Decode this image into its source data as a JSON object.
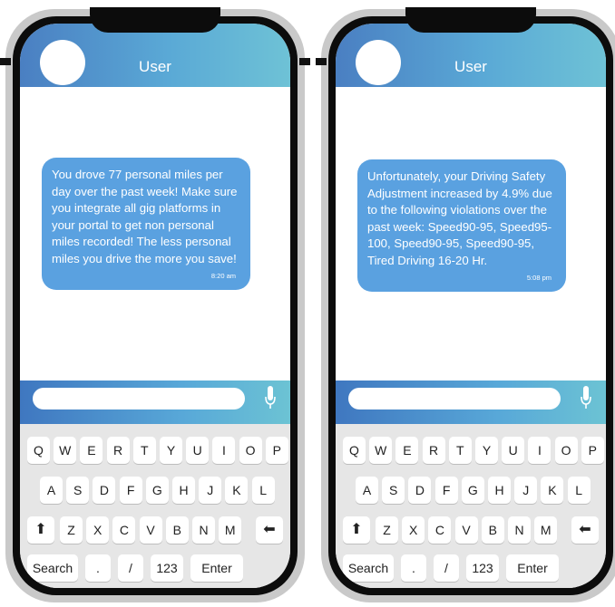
{
  "phones": [
    {
      "header_title": "User",
      "message": "You drove 77 personal miles per day over the past week! Make sure you integrate all gig platforms in your portal to get non personal miles recorded! The less personal miles you drive the more you save!",
      "time": "8:20 am"
    },
    {
      "header_title": "User",
      "message": "Unfortunately, your Driving Safety Adjustment increased by 4.9% due to the following violations over the past week: Speed90-95, Speed95-100, Speed90-95, Speed90-95, Tired Driving 16-20 Hr.",
      "time": "5:08 pm"
    }
  ],
  "keyboard": {
    "row1": [
      "Q",
      "W",
      "E",
      "R",
      "T",
      "Y",
      "U",
      "I",
      "O",
      "P"
    ],
    "row2": [
      "A",
      "S",
      "D",
      "F",
      "G",
      "H",
      "J",
      "K",
      "L"
    ],
    "shift_icon": "arrow-up-icon",
    "row3": [
      "Z",
      "X",
      "C",
      "V",
      "B",
      "N",
      "M"
    ],
    "backspace_icon": "arrow-left-icon",
    "bottom": [
      "Search",
      ".",
      "/",
      "123",
      "Enter"
    ]
  },
  "colors": {
    "header_gradient_start": "#4a7fc2",
    "header_gradient_end": "#6ec2d6",
    "bubble": "#5aa1e0",
    "keyboard_bg": "#e6e6e6"
  }
}
